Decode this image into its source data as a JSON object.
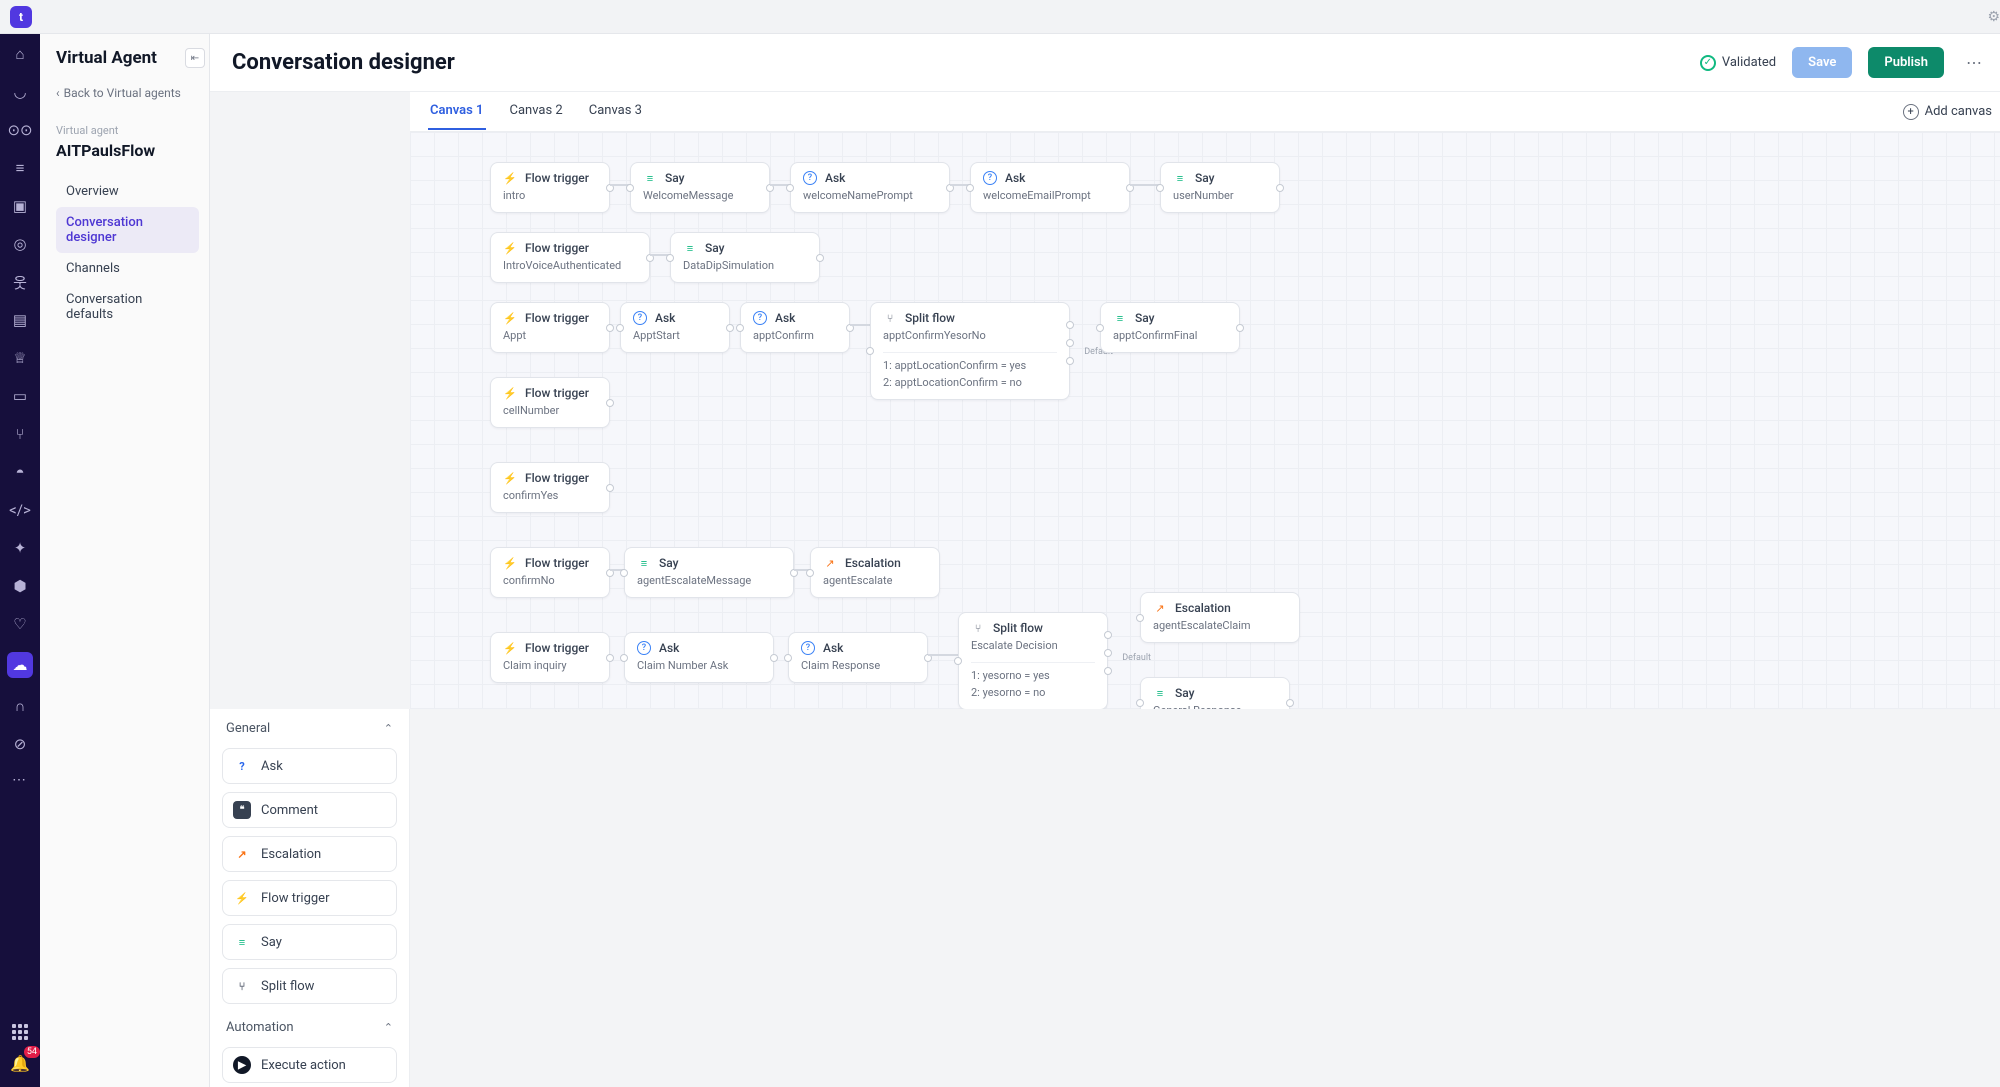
{
  "systembar": {
    "logo_letter": "t"
  },
  "rail": {
    "notification_count": "54"
  },
  "sidebar": {
    "title": "Virtual Agent",
    "back_label": "Back to Virtual agents",
    "kicker": "Virtual agent",
    "agent_name": "AITPaulsFlow",
    "nav": {
      "overview": "Overview",
      "designer": "Conversation designer",
      "channels": "Channels",
      "defaults": "Conversation defaults"
    }
  },
  "header": {
    "title": "Conversation designer",
    "validated": "Validated",
    "save": "Save",
    "publish": "Publish"
  },
  "palette": {
    "general_title": "General",
    "automation_title": "Automation",
    "items": {
      "ask": "Ask",
      "comment": "Comment",
      "escalation": "Escalation",
      "flow_trigger": "Flow trigger",
      "say": "Say",
      "split_flow": "Split flow",
      "execute_action": "Execute action"
    }
  },
  "tabs": {
    "canvas1": "Canvas 1",
    "canvas2": "Canvas 2",
    "canvas3": "Canvas 3",
    "add": "Add canvas"
  },
  "node_types": {
    "flow_trigger": "Flow trigger",
    "say": "Say",
    "ask": "Ask",
    "escalation": "Escalation",
    "split_flow": "Split flow"
  },
  "nodes": {
    "r1": {
      "ft": "intro",
      "say": "WelcomeMessage",
      "ask1": "welcomeNamePrompt",
      "ask2": "welcomeEmailPrompt",
      "say2": "userNumber"
    },
    "r2": {
      "ft": "IntroVoiceAuthenticated",
      "say": "DataDipSimulation"
    },
    "r3": {
      "ft": "Appt",
      "ask1": "ApptStart",
      "ask2": "apptConfirm",
      "split_title": "apptConfirmYesorNo",
      "split_b1": "1: apptLocationConfirm = yes",
      "split_b2": "2: apptLocationConfirm = no",
      "split_default": "Default",
      "say": "apptConfirmFinal"
    },
    "r4": {
      "ft": "cellNumber"
    },
    "r5": {
      "ft": "confirmYes"
    },
    "r6": {
      "ft": "confirmNo",
      "say": "agentEscalateMessage",
      "esc": "agentEscalate"
    },
    "r7": {
      "ft": "Claim inquiry",
      "ask1": "Claim Number Ask",
      "ask2": "Claim Response",
      "split_title": "Escalate Decision",
      "split_b1": "1: yesorno = yes",
      "split_b2": "2: yesorno = no",
      "split_default": "Default",
      "esc": "agentEscalateClaim",
      "say": "General Response"
    }
  }
}
